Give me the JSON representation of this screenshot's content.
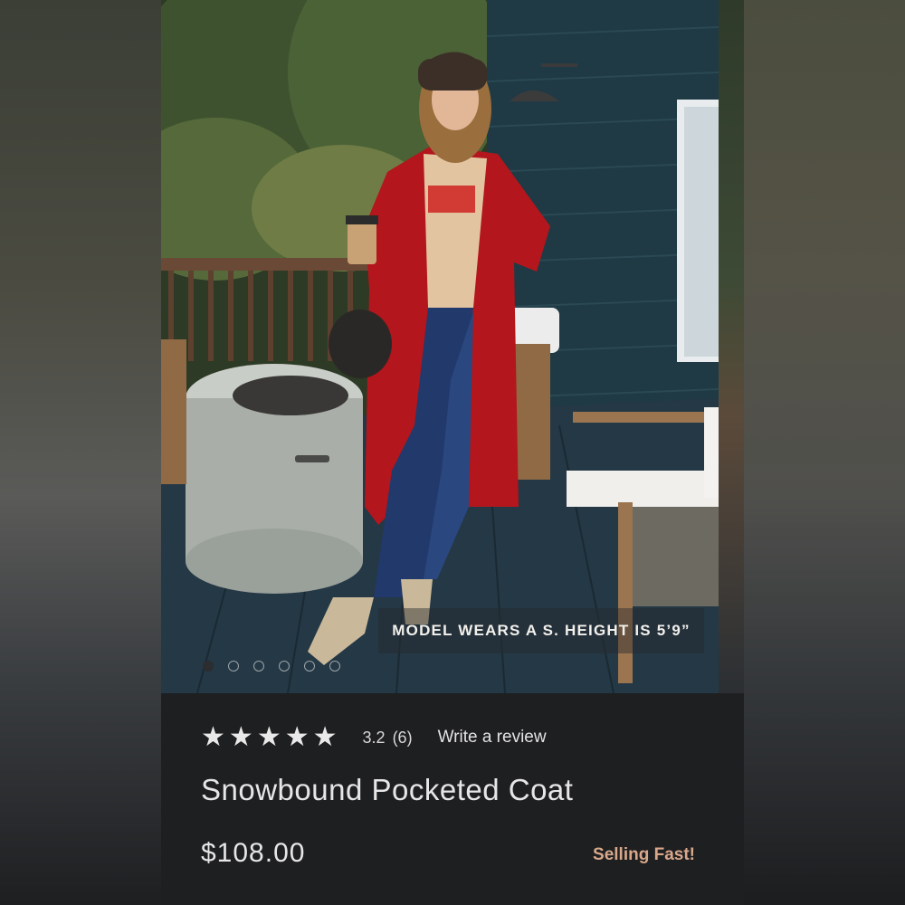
{
  "product": {
    "name": "Snowbound Pocketed Coat",
    "price": "$108.00",
    "badge": "Selling Fast!",
    "image_caption": "MODEL WEARS A S. HEIGHT IS 5’9”"
  },
  "rating": {
    "stars": 5,
    "value": "3.2",
    "count": "(6)",
    "write_review": "Write a review"
  },
  "carousel": {
    "total": 6,
    "active_index": 0
  },
  "colors": {
    "badge": "#d9a88b",
    "panel_bg": "#1e1f21",
    "coat": "#b3161c",
    "siding": "#1f3a44"
  }
}
